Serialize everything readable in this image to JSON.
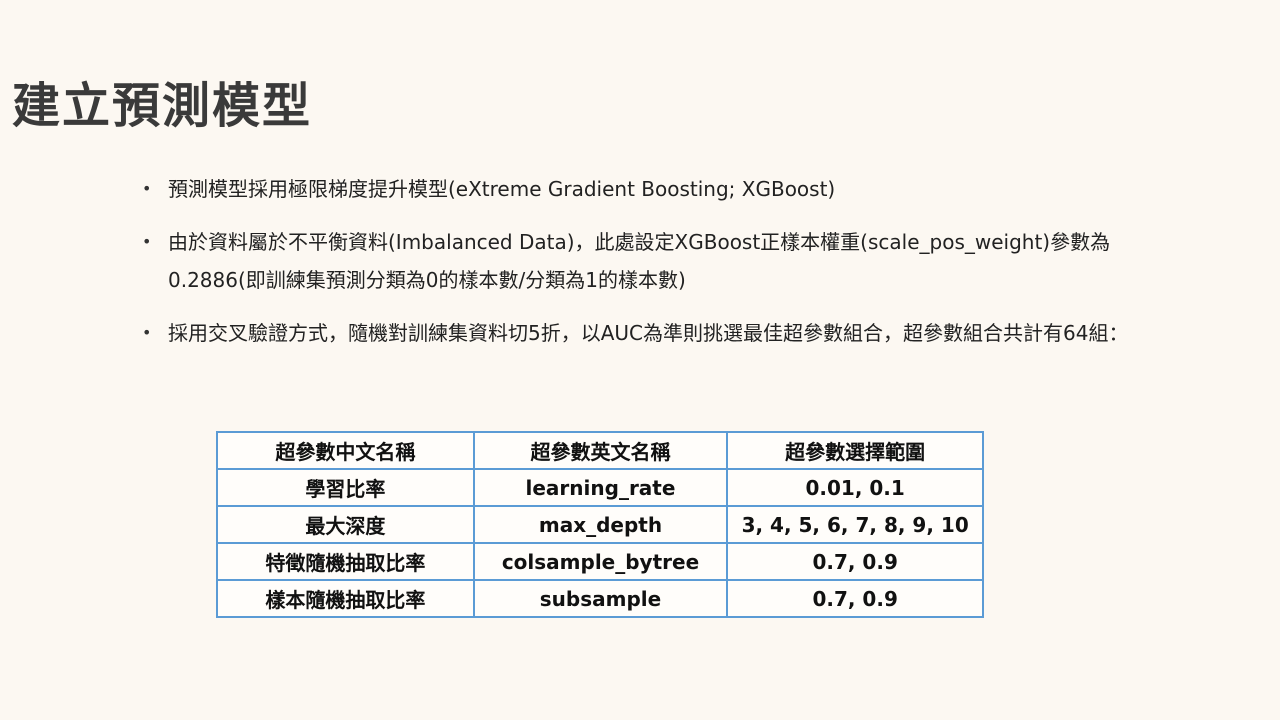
{
  "slide": {
    "title": "建立預測模型",
    "bullets": [
      "預測模型採用極限梯度提升模型(eXtreme Gradient Boosting; XGBoost)",
      "由於資料屬於不平衡資料(Imbalanced Data)，此處設定XGBoost正樣本權重(scale_pos_weight)參數為0.2886(即訓練集預測分類為0的樣本數/分類為1的樣本數)",
      "採用交叉驗證方式，隨機對訓練集資料切5折，以AUC為準則挑選最佳超參數組合，超參數組合共計有64組："
    ],
    "bullet_symbol": "•"
  },
  "table": {
    "headers": [
      "超參數中文名稱",
      "超參數英文名稱",
      "超參數選擇範圍"
    ],
    "rows": [
      [
        "學習比率",
        "learning_rate",
        "0.01, 0.1"
      ],
      [
        "最大深度",
        "max_depth",
        "3, 4, 5, 6, 7, 8, 9, 10"
      ],
      [
        "特徵隨機抽取比率",
        "colsample_bytree",
        "0.7, 0.9"
      ],
      [
        "樣本隨機抽取比率",
        "subsample",
        "0.7, 0.9"
      ]
    ]
  },
  "colors": {
    "background": "#fcf8f2",
    "table_border": "#5b9bd5",
    "title": "#3a3a3a"
  }
}
